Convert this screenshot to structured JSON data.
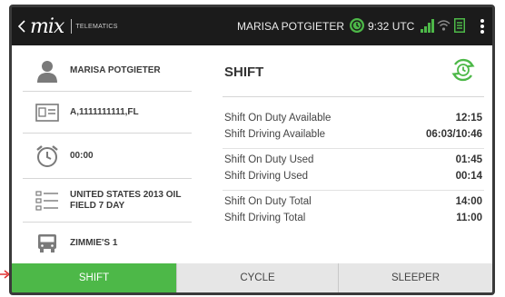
{
  "topbar": {
    "logo_text": "mix",
    "logo_subtitle": "TELEMATICS",
    "driver_name": "MARISA POTGIETER",
    "time": "9:32 UTC",
    "icons": [
      "back-chevron-icon",
      "clock-sync-icon",
      "signal-icon",
      "wifi-icon",
      "logbook-icon",
      "overflow-menu-icon"
    ]
  },
  "left_panel": {
    "items": [
      {
        "icon": "person-icon",
        "label": "MARISA POTGIETER"
      },
      {
        "icon": "id-card-icon",
        "label": "A,1111111111,FL"
      },
      {
        "icon": "alarm-clock-icon",
        "label": "00:00"
      },
      {
        "icon": "ruleset-list-icon",
        "label": "UNITED STATES 2013 OIL FIELD 7 DAY"
      },
      {
        "icon": "truck-icon",
        "label": "ZIMMIE'S 1"
      }
    ]
  },
  "shift": {
    "title": "SHIFT",
    "rows": [
      {
        "label": "Shift On Duty Available",
        "value": "12:15"
      },
      {
        "label": "Shift Driving Available",
        "value": "06:03/10:46"
      },
      {
        "label": "Shift On Duty Used",
        "value": "01:45"
      },
      {
        "label": "Shift Driving Used",
        "value": "00:14"
      },
      {
        "label": "Shift On Duty Total",
        "value": "14:00"
      },
      {
        "label": "Shift Driving Total",
        "value": "11:00"
      }
    ]
  },
  "tabs": [
    {
      "label": "SHIFT",
      "active": true
    },
    {
      "label": "CYCLE",
      "active": false
    },
    {
      "label": "SLEEPER",
      "active": false
    }
  ],
  "colors": {
    "accent_green": "#4db848",
    "topbar_bg": "#1b1b1b",
    "tab_inactive_bg": "#e6e6e6"
  }
}
